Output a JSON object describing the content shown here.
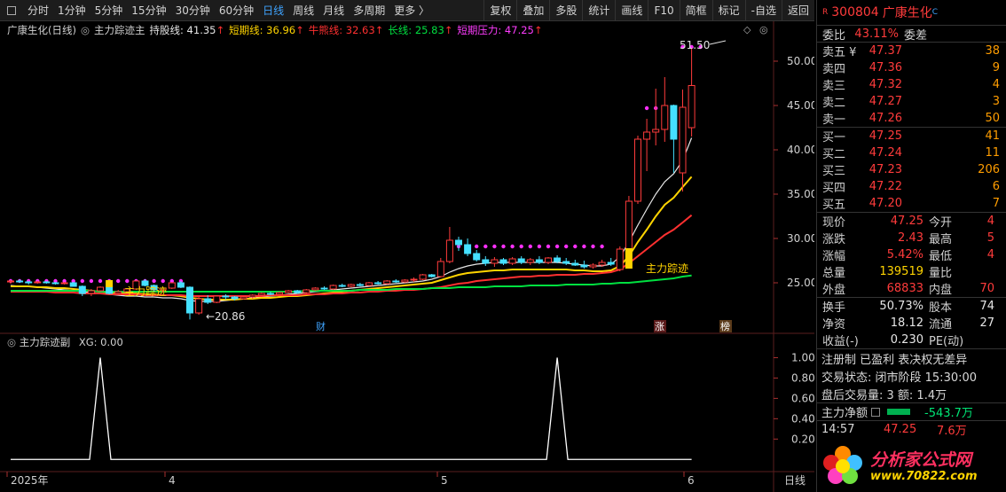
{
  "toolbar": {
    "left_items": [
      "分时",
      "1分钟",
      "5分钟",
      "15分钟",
      "30分钟",
      "60分钟",
      "日线",
      "周线",
      "月线",
      "多周期",
      "更多 〉"
    ],
    "active": "日线",
    "right_items": [
      "复权",
      "叠加",
      "多股",
      "统计",
      "画线",
      "F10",
      "简框",
      "标记",
      "-自选",
      "返回"
    ]
  },
  "legend": {
    "title": "广康生化(日线)",
    "indicator": "主力踪迹主",
    "items": [
      {
        "label": "持股线: 41.35",
        "color": "#e6e6e6",
        "arrow": "↑"
      },
      {
        "label": "短期线: 36.96",
        "color": "#ffd400",
        "arrow": "↑"
      },
      {
        "label": "牛熊线: 32.63",
        "color": "#ff3030",
        "arrow": "↑"
      },
      {
        "label": "长线: 25.83",
        "color": "#00e040",
        "arrow": "↑"
      },
      {
        "label": "短期压力: 47.25",
        "color": "#ff3cff",
        "arrow": "↑"
      }
    ]
  },
  "sub_legend": {
    "indicator": "主力踪迹副",
    "value": "XG: 0.00"
  },
  "chart_labels": {
    "high": "51.50",
    "low": "←20.86",
    "zhuli1": "主力踪迹",
    "zhuli2": "主力踪迹",
    "cai": "财",
    "zhang": "涨",
    "bang": "榜"
  },
  "chart_data": [
    {
      "type": "candlestick",
      "title": "广康生化(日线)",
      "y_ticks": [
        50,
        45,
        40,
        35,
        30,
        25
      ],
      "ylim": [
        19.5,
        52.5
      ],
      "x_ticks": [
        "2025年",
        "4",
        "5",
        "6"
      ],
      "period": "日线",
      "candles": [
        [
          25.1,
          25.3,
          24.9,
          25.2
        ],
        [
          25.2,
          25.4,
          25.0,
          25.1
        ],
        [
          25.1,
          25.2,
          24.8,
          25.0
        ],
        [
          25.0,
          25.2,
          24.9,
          25.1
        ],
        [
          25.1,
          25.2,
          24.9,
          25.0
        ],
        [
          25.0,
          25.1,
          24.8,
          24.9
        ],
        [
          24.9,
          25.1,
          24.8,
          25.0
        ],
        [
          25.0,
          25.1,
          24.6,
          24.6
        ],
        [
          24.6,
          24.7,
          23.5,
          23.8
        ],
        [
          23.8,
          24.3,
          23.5,
          24.1
        ],
        [
          24.1,
          24.6,
          24.0,
          24.5
        ],
        [
          24.5,
          24.6,
          23.7,
          23.8
        ],
        [
          23.8,
          24.2,
          23.6,
          24.0
        ],
        [
          24.0,
          24.4,
          23.9,
          24.3
        ],
        [
          24.3,
          25.3,
          24.2,
          25.2
        ],
        [
          25.2,
          25.4,
          24.6,
          24.7
        ],
        [
          24.7,
          24.8,
          24.0,
          24.2
        ],
        [
          24.2,
          24.5,
          23.9,
          24.4
        ],
        [
          24.4,
          25.1,
          24.3,
          25.0
        ],
        [
          25.0,
          25.2,
          24.4,
          24.5
        ],
        [
          24.5,
          24.6,
          20.86,
          21.6
        ],
        [
          21.6,
          23.4,
          21.4,
          23.2
        ],
        [
          23.2,
          23.6,
          22.6,
          22.8
        ],
        [
          22.8,
          23.6,
          22.7,
          23.5
        ],
        [
          23.5,
          23.7,
          23.1,
          23.4
        ],
        [
          23.4,
          23.5,
          23.0,
          23.2
        ],
        [
          23.2,
          23.5,
          23.1,
          23.4
        ],
        [
          23.4,
          23.7,
          23.2,
          23.6
        ],
        [
          23.6,
          23.9,
          23.5,
          23.8
        ],
        [
          23.8,
          24.0,
          23.6,
          23.7
        ],
        [
          23.7,
          24.0,
          23.6,
          23.9
        ],
        [
          23.9,
          24.2,
          23.8,
          24.1
        ],
        [
          24.1,
          24.2,
          23.8,
          23.9
        ],
        [
          23.9,
          24.3,
          23.8,
          24.2
        ],
        [
          24.2,
          24.5,
          24.1,
          24.4
        ],
        [
          24.4,
          24.6,
          24.2,
          24.3
        ],
        [
          24.3,
          24.8,
          24.2,
          24.7
        ],
        [
          24.7,
          24.9,
          24.5,
          24.6
        ],
        [
          24.6,
          24.9,
          24.5,
          24.8
        ],
        [
          24.8,
          25.0,
          24.6,
          24.7
        ],
        [
          24.7,
          25.1,
          24.6,
          25.0
        ],
        [
          25.0,
          25.2,
          24.8,
          24.9
        ],
        [
          24.9,
          25.3,
          24.8,
          25.2
        ],
        [
          25.2,
          25.4,
          25.0,
          25.1
        ],
        [
          25.1,
          25.4,
          25.0,
          25.3
        ],
        [
          25.3,
          25.6,
          25.1,
          25.4
        ],
        [
          25.4,
          26.0,
          25.3,
          25.9
        ],
        [
          25.9,
          26.0,
          25.6,
          25.7
        ],
        [
          25.7,
          27.8,
          25.6,
          27.4
        ],
        [
          27.4,
          31.3,
          27.2,
          29.8
        ],
        [
          29.8,
          30.2,
          28.6,
          29.3
        ],
        [
          29.3,
          30.0,
          28.0,
          28.3
        ],
        [
          28.3,
          28.7,
          27.4,
          27.6
        ],
        [
          27.6,
          28.0,
          26.9,
          27.2
        ],
        [
          27.2,
          27.9,
          26.8,
          27.6
        ],
        [
          27.6,
          27.8,
          27.0,
          27.2
        ],
        [
          27.2,
          27.9,
          27.0,
          27.7
        ],
        [
          27.7,
          28.0,
          27.1,
          27.3
        ],
        [
          27.3,
          27.8,
          27.0,
          27.6
        ],
        [
          27.6,
          28.0,
          27.1,
          27.3
        ],
        [
          27.3,
          27.9,
          27.1,
          27.8
        ],
        [
          27.8,
          28.1,
          27.2,
          27.4
        ],
        [
          27.4,
          27.8,
          27.0,
          27.2
        ],
        [
          27.2,
          27.6,
          26.9,
          27.0
        ],
        [
          27.0,
          27.5,
          26.6,
          26.8
        ],
        [
          26.8,
          27.2,
          26.6,
          27.0
        ],
        [
          27.0,
          27.6,
          26.8,
          27.3
        ],
        [
          27.3,
          27.8,
          26.9,
          27.1
        ],
        [
          26.5,
          29.1,
          26.3,
          28.8
        ],
        [
          28.8,
          34.8,
          28.6,
          34.2
        ],
        [
          34.2,
          41.6,
          33.9,
          41.2
        ],
        [
          41.2,
          43.5,
          37.6,
          42.0
        ],
        [
          42.0,
          46.9,
          40.5,
          42.3
        ],
        [
          42.3,
          48.2,
          40.9,
          45.0
        ],
        [
          45.0,
          45.1,
          37.4,
          41.2
        ],
        [
          37.4,
          46.8,
          35.3,
          44.8
        ],
        [
          42.5,
          51.5,
          41.5,
          47.25
        ]
      ],
      "series": [
        {
          "name": "持股线",
          "color": "#e6e6e6",
          "values": [
            24.7,
            24.6,
            24.6,
            24.5,
            24.4,
            24.3,
            24.2,
            24.1,
            24.0,
            23.9,
            23.8,
            23.7,
            23.6,
            23.5,
            23.5,
            23.4,
            23.4,
            23.3,
            23.3,
            23.2,
            23.0,
            22.9,
            22.9,
            22.9,
            23.0,
            23.1,
            23.2,
            23.3,
            23.4,
            23.5,
            23.6,
            23.7,
            23.8,
            23.9,
            24.0,
            24.1,
            24.2,
            24.3,
            24.4,
            24.5,
            24.6,
            24.7,
            24.8,
            24.9,
            25.0,
            25.1,
            25.2,
            25.4,
            25.7,
            26.2,
            26.6,
            26.9,
            27.1,
            27.2,
            27.3,
            27.3,
            27.3,
            27.3,
            27.3,
            27.3,
            27.3,
            27.3,
            27.2,
            27.1,
            27.0,
            26.9,
            26.9,
            27.1,
            27.9,
            29.6,
            31.5,
            33.3,
            35.0,
            36.4,
            37.3,
            38.8,
            41.35
          ]
        },
        {
          "name": "短期线",
          "color": "#ffd400",
          "values": [
            24.6,
            24.6,
            24.6,
            24.5,
            24.5,
            24.4,
            24.4,
            24.3,
            24.2,
            24.1,
            24.0,
            23.9,
            23.9,
            23.8,
            23.8,
            23.7,
            23.7,
            23.6,
            23.6,
            23.5,
            23.3,
            23.2,
            23.1,
            23.1,
            23.1,
            23.1,
            23.2,
            23.2,
            23.3,
            23.3,
            23.4,
            23.5,
            23.5,
            23.6,
            23.7,
            23.8,
            23.9,
            24.0,
            24.1,
            24.2,
            24.3,
            24.4,
            24.5,
            24.6,
            24.7,
            24.8,
            24.9,
            25.0,
            25.3,
            25.6,
            25.9,
            26.1,
            26.2,
            26.3,
            26.4,
            26.4,
            26.5,
            26.5,
            26.5,
            26.5,
            26.5,
            26.5,
            26.5,
            26.4,
            26.4,
            26.3,
            26.3,
            26.4,
            26.9,
            28.0,
            29.6,
            31.0,
            32.5,
            33.8,
            34.6,
            35.8,
            36.96
          ]
        },
        {
          "name": "牛熊线",
          "color": "#ff3030",
          "values": [
            24.0,
            24.0,
            24.0,
            24.0,
            24.0,
            23.9,
            23.9,
            23.9,
            23.8,
            23.8,
            23.8,
            23.7,
            23.7,
            23.7,
            23.7,
            23.6,
            23.6,
            23.6,
            23.6,
            23.6,
            23.5,
            23.5,
            23.5,
            23.5,
            23.5,
            23.5,
            23.5,
            23.5,
            23.5,
            23.6,
            23.6,
            23.6,
            23.6,
            23.7,
            23.7,
            23.7,
            23.8,
            23.8,
            23.9,
            23.9,
            24.0,
            24.0,
            24.1,
            24.1,
            24.2,
            24.2,
            24.3,
            24.4,
            24.5,
            24.7,
            24.9,
            25.0,
            25.2,
            25.3,
            25.4,
            25.5,
            25.6,
            25.7,
            25.7,
            25.8,
            25.8,
            25.9,
            25.9,
            25.9,
            26.0,
            26.0,
            26.1,
            26.2,
            26.5,
            27.2,
            28.0,
            28.8,
            29.6,
            30.4,
            31.0,
            31.8,
            32.63
          ]
        },
        {
          "name": "长线",
          "color": "#00e040",
          "values": [
            24.1,
            24.1,
            24.1,
            24.1,
            24.1,
            24.1,
            24.1,
            24.1,
            24.1,
            24.1,
            24.0,
            24.0,
            24.0,
            24.0,
            24.0,
            24.0,
            24.0,
            24.0,
            24.0,
            24.0,
            24.0,
            24.0,
            24.0,
            24.0,
            24.0,
            24.0,
            24.0,
            24.0,
            24.0,
            24.0,
            24.0,
            24.0,
            24.0,
            24.1,
            24.1,
            24.1,
            24.1,
            24.1,
            24.1,
            24.2,
            24.2,
            24.2,
            24.2,
            24.3,
            24.3,
            24.3,
            24.3,
            24.4,
            24.4,
            24.4,
            24.5,
            24.5,
            24.5,
            24.5,
            24.6,
            24.6,
            24.6,
            24.6,
            24.7,
            24.7,
            24.7,
            24.7,
            24.8,
            24.8,
            24.8,
            24.8,
            24.9,
            24.9,
            25.0,
            25.0,
            25.1,
            25.2,
            25.3,
            25.4,
            25.5,
            25.7,
            25.83
          ]
        }
      ],
      "short_pressure": [
        25.2,
        25.2,
        25.2,
        25.2,
        25.2,
        25.2,
        25.2,
        25.2,
        25.2,
        25.2,
        25.2,
        25.2,
        25.2,
        25.2,
        25.2,
        25.2,
        25.2,
        25.2,
        25.2,
        25.2,
        null,
        null,
        null,
        null,
        null,
        null,
        null,
        null,
        null,
        null,
        null,
        null,
        null,
        null,
        null,
        null,
        null,
        null,
        null,
        null,
        null,
        null,
        null,
        null,
        null,
        null,
        null,
        null,
        null,
        29.1,
        29.1,
        29.1,
        29.1,
        29.1,
        29.1,
        29.1,
        29.1,
        29.1,
        29.1,
        29.1,
        29.1,
        29.1,
        29.1,
        29.1,
        29.1,
        29.1,
        29.1,
        null,
        null,
        null,
        null,
        44.7,
        44.7,
        44.7,
        44.7,
        51.6,
        51.6,
        51.6
      ]
    },
    {
      "type": "line",
      "title": "主力踪迹副",
      "y_ticks": [
        1.0,
        0.8,
        0.6,
        0.4,
        0.2
      ],
      "ylim": [
        -0.12,
        1.1
      ],
      "series": [
        {
          "name": "XG",
          "color": "#ffffff",
          "peaks": [
            10,
            61
          ],
          "values_baseline": 0
        }
      ]
    }
  ],
  "quote": {
    "code": "300804",
    "name": "广康生化",
    "flag": "R",
    "weibi_label": "委比",
    "weibi_value": "43.11%",
    "weicha_label": "委差",
    "asks": [
      {
        "label": "卖五",
        "price": "47.37",
        "vol": "38",
        "mark": "¥"
      },
      {
        "label": "卖四",
        "price": "47.36",
        "vol": "9"
      },
      {
        "label": "卖三",
        "price": "47.32",
        "vol": "4"
      },
      {
        "label": "卖二",
        "price": "47.27",
        "vol": "3"
      },
      {
        "label": "卖一",
        "price": "47.26",
        "vol": "50"
      }
    ],
    "bids": [
      {
        "label": "买一",
        "price": "47.25",
        "vol": "41"
      },
      {
        "label": "买二",
        "price": "47.24",
        "vol": "11"
      },
      {
        "label": "买三",
        "price": "47.23",
        "vol": "206"
      },
      {
        "label": "买四",
        "price": "47.22",
        "vol": "6"
      },
      {
        "label": "买五",
        "price": "47.20",
        "vol": "7"
      }
    ],
    "stats": [
      {
        "l": "现价",
        "v": "47.25",
        "l2": "今开",
        "v2": "4"
      },
      {
        "l": "涨跌",
        "v": "2.43",
        "l2": "最高",
        "v2": "5"
      },
      {
        "l": "涨幅",
        "v": "5.42%",
        "l2": "最低",
        "v2": "4"
      },
      {
        "l": "总量",
        "v": "139519",
        "l2": "量比",
        "v2": ""
      },
      {
        "l": "外盘",
        "v": "68833",
        "l2": "内盘",
        "v2": "70"
      }
    ],
    "stats2": [
      {
        "l": "换手",
        "v": "50.73%",
        "l2": "股本",
        "v2": "74"
      },
      {
        "l": "净资",
        "v": "18.12",
        "l2": "流通",
        "v2": "27"
      },
      {
        "l": "收益(-)",
        "v": "0.230",
        "l2": "PE(动)",
        "v2": ""
      }
    ],
    "notes": [
      "注册制 已盈利 表决权无差异",
      "交易状态: 闭市阶段 15:30:00",
      "盘后交易量: 3  额: 1.4万"
    ],
    "net_label": "主力净额",
    "net_value": "-543.7万",
    "tick_time": "14:57",
    "tick_price": "47.25",
    "tick_vol": "7.6万",
    "logo_text": "分析家公式网",
    "logo_url": "www.70822.com"
  }
}
